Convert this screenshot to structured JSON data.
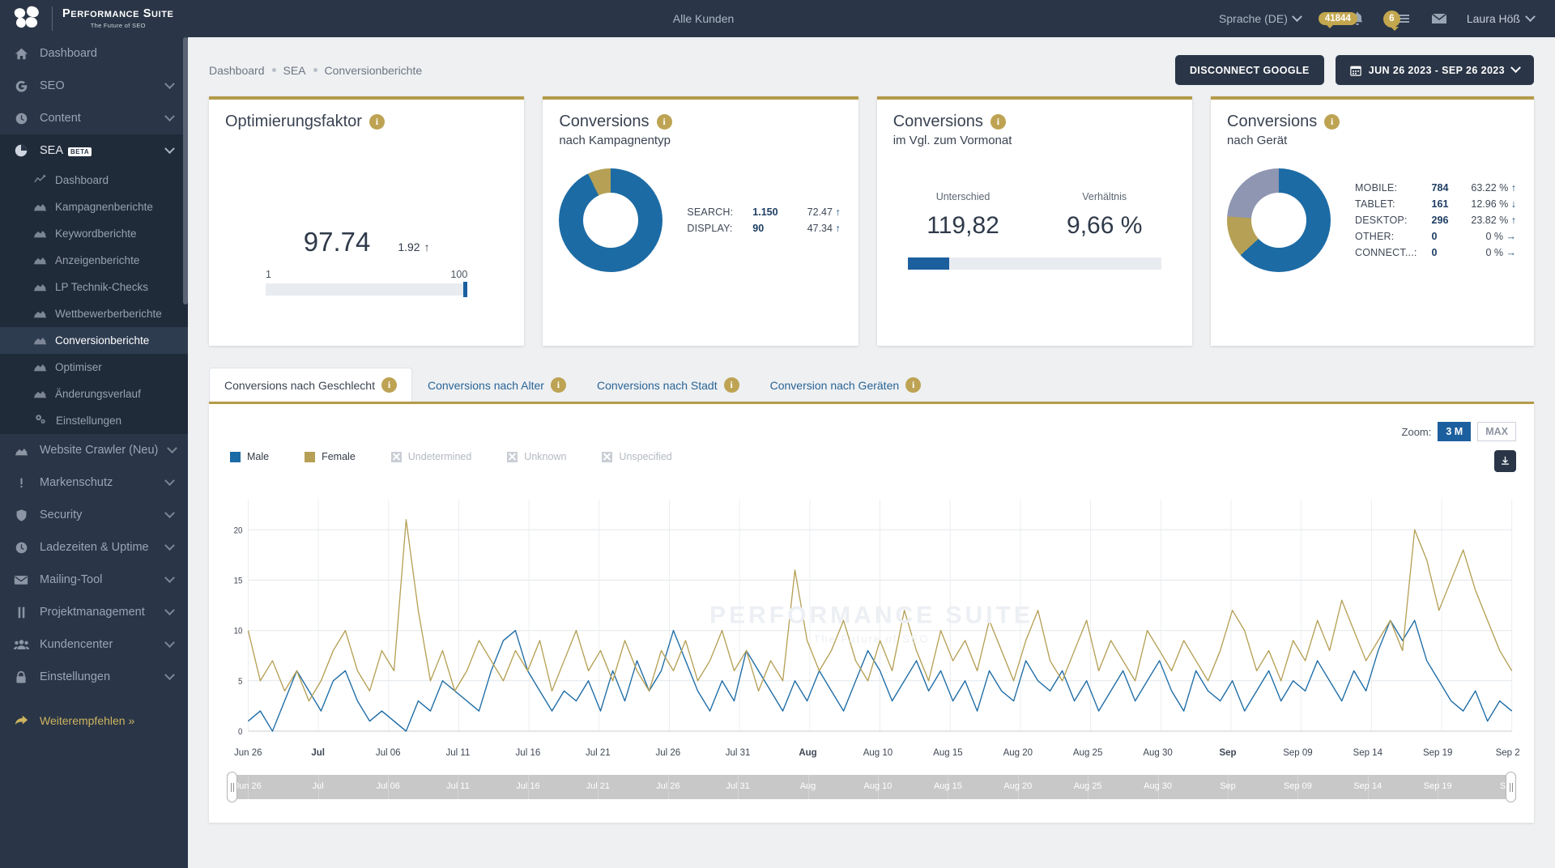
{
  "brand": {
    "title_caps": "P",
    "title": "ERFORMANCE ",
    "title2_caps": "S",
    "title3": "UITE",
    "tagline": "The Future of SEO"
  },
  "topbar": {
    "center": "Alle Kunden",
    "language": "Sprache (DE)",
    "notifications_count": "41844",
    "tasks_count": "6",
    "user": "Laura Höß"
  },
  "sidebar": {
    "items": [
      {
        "label": "Dashboard",
        "icon": "home-icon",
        "chevron": false
      },
      {
        "label": "SEO",
        "icon": "google-icon",
        "chevron": true
      },
      {
        "label": "Content",
        "icon": "clock-icon",
        "chevron": true
      }
    ],
    "sea": {
      "label": "SEA",
      "badge": "BETA",
      "icon": "pie-chart-icon"
    },
    "sea_children": [
      {
        "label": "Dashboard",
        "icon": "line-chart-icon",
        "active": false
      },
      {
        "label": "Kampagnenberichte",
        "icon": "area-chart-icon",
        "active": false
      },
      {
        "label": "Keywordberichte",
        "icon": "area-chart-icon",
        "active": false
      },
      {
        "label": "Anzeigenberichte",
        "icon": "area-chart-icon",
        "active": false
      },
      {
        "label": "LP Technik-Checks",
        "icon": "area-chart-icon",
        "active": false
      },
      {
        "label": "Wettbewerberberichte",
        "icon": "area-chart-icon",
        "active": false
      },
      {
        "label": "Conversionberichte",
        "icon": "area-chart-icon",
        "active": true
      },
      {
        "label": "Optimiser",
        "icon": "area-chart-icon",
        "active": false
      },
      {
        "label": "Änderungsverlauf",
        "icon": "area-chart-icon",
        "active": false
      },
      {
        "label": "Einstellungen",
        "icon": "gears-icon",
        "active": false
      }
    ],
    "items_after": [
      {
        "label": "Website Crawler (Neu)",
        "icon": "area-chart-icon",
        "chevron": true
      },
      {
        "label": "Markenschutz",
        "icon": "exclamation-icon",
        "chevron": true
      },
      {
        "label": "Security",
        "icon": "shield-icon",
        "chevron": true
      },
      {
        "label": "Ladezeiten & Uptime",
        "icon": "clock-icon",
        "chevron": true
      },
      {
        "label": "Mailing-Tool",
        "icon": "envelope-icon",
        "chevron": true
      },
      {
        "label": "Projektmanagement",
        "icon": "road-icon",
        "chevron": true
      },
      {
        "label": "Kundencenter",
        "icon": "users-icon",
        "chevron": true
      },
      {
        "label": "Einstellungen",
        "icon": "lock-icon",
        "chevron": true
      }
    ],
    "promo": {
      "label": "Weiterempfehlen »",
      "icon": "share-arrow-icon"
    }
  },
  "breadcrumb": {
    "root": "Dashboard",
    "level2": "SEA",
    "current": "Conversionberichte"
  },
  "actions": {
    "disconnect": "DISCONNECT GOOGLE",
    "daterange": "JUN 26 2023 - SEP 26 2023",
    "calendar_icon": "calendar-icon"
  },
  "cards": {
    "optimierungsfaktor": {
      "title": "Optimierungsfaktor",
      "value": "97.74",
      "delta": "1.92",
      "delta_dir": "↑",
      "scale_min": "1",
      "scale_max": "100",
      "gauge_percent": 97.74
    },
    "kampagnentyp": {
      "title": "Conversions",
      "subtitle": "nach Kampagnentyp",
      "rows": [
        {
          "key": "SEARCH:",
          "value": "1.150",
          "pct": "72.47",
          "dir": "↑"
        },
        {
          "key": "DISPLAY:",
          "value": "90",
          "pct": "47.34",
          "dir": "↑"
        }
      ],
      "donut": [
        {
          "name": "Search",
          "share": 92.8,
          "color": "#1c6ba5"
        },
        {
          "name": "Display",
          "share": 7.2,
          "color": "#b5a055"
        }
      ]
    },
    "vormonat": {
      "title": "Conversions",
      "subtitle": "im Vgl. zum Vormonat",
      "label_diff": "Unterschied",
      "label_ratio": "Verhältnis",
      "value_diff": "119,82",
      "value_ratio": "9,66 %",
      "bar_percent": 9.66
    },
    "geraet": {
      "title": "Conversions",
      "subtitle": "nach Gerät",
      "rows": [
        {
          "key": "MOBILE:",
          "value": "784",
          "pct": "63.22 %",
          "dir": "↑"
        },
        {
          "key": "TABLET:",
          "value": "161",
          "pct": "12.96 %",
          "dir": "↓"
        },
        {
          "key": "DESKTOP:",
          "value": "296",
          "pct": "23.82 %",
          "dir": "↑"
        },
        {
          "key": "OTHER:",
          "value": "0",
          "pct": "0 %",
          "dir": "→"
        },
        {
          "key": "CONNECT...:",
          "value": "0",
          "pct": "0 %",
          "dir": "→"
        }
      ],
      "donut": [
        {
          "name": "Mobile",
          "share": 63.22,
          "color": "#1c6ba5"
        },
        {
          "name": "Tablet",
          "share": 12.96,
          "color": "#b5a055"
        },
        {
          "name": "Desktop",
          "share": 23.82,
          "color": "#8e96b2"
        }
      ]
    }
  },
  "tabs": [
    {
      "label": "Conversions nach Geschlecht",
      "active": true
    },
    {
      "label": "Conversions nach Alter",
      "active": false
    },
    {
      "label": "Conversions nach Stadt",
      "active": false
    },
    {
      "label": "Conversion nach Geräten",
      "active": false
    }
  ],
  "chart_panel": {
    "zoom_label": "Zoom:",
    "zoom_options": [
      {
        "label": "3 M",
        "active": true
      },
      {
        "label": "MAX",
        "active": false
      }
    ],
    "download_icon": "download-icon",
    "watermark_title": "PERFORMANCE SUITE",
    "watermark_sub": "The Future of SEO"
  },
  "chart_data": {
    "type": "line",
    "title": "Conversions nach Geschlecht",
    "xlabel": "",
    "ylabel": "",
    "ylim": [
      0,
      23
    ],
    "yticks": [
      0,
      5,
      10,
      15,
      20
    ],
    "grid": true,
    "legend_position": "top-left",
    "legend": [
      {
        "name": "Male",
        "color": "#1c6ba5",
        "enabled": true
      },
      {
        "name": "Female",
        "color": "#b5a055",
        "enabled": true
      },
      {
        "name": "Undetermined",
        "color": "#c9ced5",
        "enabled": false
      },
      {
        "name": "Unknown",
        "color": "#c9ced5",
        "enabled": false
      },
      {
        "name": "Unspecified",
        "color": "#c9ced5",
        "enabled": false
      }
    ],
    "x_tick_labels": [
      "Jun 26",
      "Jul",
      "Jul 06",
      "Jul 11",
      "Jul 16",
      "Jul 21",
      "Jul 26",
      "Jul 31",
      "Aug",
      "Aug 10",
      "Aug 15",
      "Aug 20",
      "Aug 25",
      "Aug 30",
      "Sep",
      "Sep 09",
      "Sep 14",
      "Sep 19",
      "Sep 2"
    ],
    "x_tick_bold": [
      "Jul",
      "Aug",
      "Sep"
    ],
    "series": [
      {
        "name": "Male",
        "color": "#1c6ba5",
        "values": [
          1,
          2,
          0,
          3,
          6,
          4,
          2,
          5,
          6,
          3,
          1,
          2,
          1,
          0,
          3,
          2,
          5,
          4,
          3,
          2,
          6,
          9,
          10,
          6,
          4,
          2,
          4,
          3,
          5,
          2,
          6,
          3,
          7,
          4,
          6,
          10,
          7,
          4,
          2,
          5,
          3,
          8,
          6,
          4,
          2,
          5,
          3,
          6,
          4,
          2,
          5,
          8,
          6,
          3,
          5,
          7,
          4,
          6,
          3,
          5,
          2,
          6,
          4,
          3,
          7,
          5,
          4,
          6,
          3,
          5,
          2,
          4,
          6,
          3,
          5,
          7,
          4,
          2,
          6,
          4,
          3,
          5,
          2,
          4,
          6,
          3,
          5,
          4,
          7,
          5,
          3,
          6,
          4,
          8,
          11,
          9,
          11,
          7,
          5,
          3,
          2,
          4,
          1,
          3,
          2
        ]
      },
      {
        "name": "Female",
        "color": "#b5a055",
        "values": [
          10,
          5,
          7,
          4,
          6,
          3,
          5,
          8,
          10,
          6,
          4,
          8,
          6,
          21,
          12,
          5,
          8,
          4,
          6,
          9,
          7,
          5,
          8,
          6,
          9,
          4,
          7,
          10,
          6,
          8,
          5,
          9,
          6,
          4,
          8,
          6,
          9,
          5,
          7,
          10,
          6,
          8,
          4,
          7,
          5,
          16,
          9,
          6,
          8,
          11,
          7,
          5,
          9,
          6,
          12,
          8,
          5,
          10,
          7,
          9,
          6,
          11,
          8,
          5,
          9,
          12,
          7,
          5,
          8,
          11,
          6,
          9,
          7,
          5,
          10,
          8,
          6,
          9,
          7,
          5,
          8,
          12,
          10,
          6,
          8,
          5,
          9,
          7,
          11,
          8,
          13,
          10,
          7,
          9,
          11,
          8,
          20,
          17,
          12,
          15,
          18,
          14,
          11,
          8,
          6
        ]
      }
    ],
    "navigator": {
      "x_tick_labels": [
        "Jun 26",
        "Jul",
        "Jul 06",
        "Jul 11",
        "Jul 16",
        "Jul 21",
        "Jul 26",
        "Jul 31",
        "Aug",
        "Aug 10",
        "Aug 15",
        "Aug 20",
        "Aug 25",
        "Aug 30",
        "Sep",
        "Sep 09",
        "Sep 14",
        "Sep 19",
        "Sep"
      ],
      "selection_start_pct": 0,
      "selection_end_pct": 100
    }
  }
}
